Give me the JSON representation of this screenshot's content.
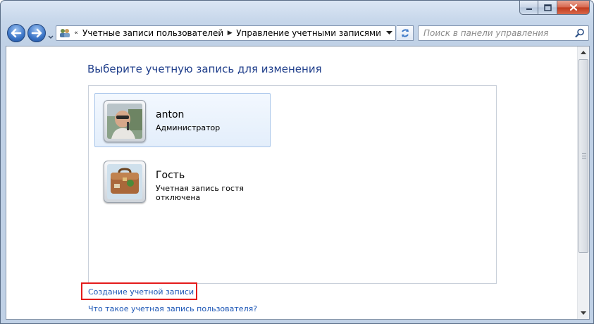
{
  "window": {
    "caption_buttons": {
      "minimize_icon": "minimize-icon",
      "maximize_icon": "maximize-icon",
      "close_icon": "close-icon"
    }
  },
  "navigation": {
    "back_icon": "back-arrow-icon",
    "forward_icon": "forward-arrow-icon",
    "history_icon": "chevron-down-icon"
  },
  "address_bar": {
    "location_icon": "control-panel-users-icon",
    "breadcrumbs": [
      "Учетные записи пользователей",
      "Управление учетными записями"
    ],
    "overflow_marker": "«"
  },
  "search": {
    "placeholder": "Поиск в панели управления",
    "icon": "search-icon"
  },
  "page": {
    "title": "Выберите учетную запись для изменения"
  },
  "accounts": [
    {
      "name": "anton",
      "role": "Администратор",
      "avatar": "user-photo-avatar",
      "selected": true
    },
    {
      "name": "Гость",
      "role": "Учетная запись гостя отключена",
      "avatar": "briefcase-avatar",
      "selected": false
    }
  ],
  "links": {
    "create_account": "Создание учетной записи",
    "what_is_account": "Что такое учетная запись пользователя?"
  },
  "colors": {
    "link": "#1b55b5",
    "title": "#1e3d8a",
    "highlight_box": "#e41b1b",
    "selection_bg": "#e3eefb"
  }
}
